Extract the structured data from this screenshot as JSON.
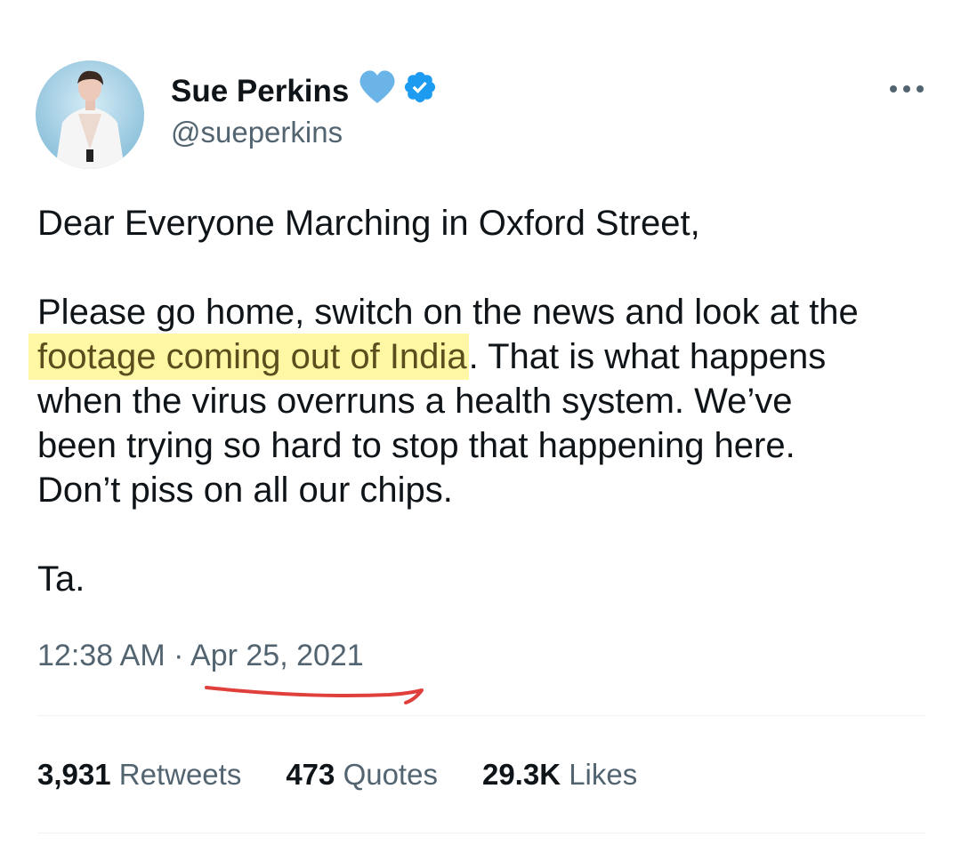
{
  "author": {
    "display_name": "Sue Perkins",
    "handle": "@sueperkins",
    "badges": [
      "blue-heart-icon",
      "verified-badge-icon"
    ]
  },
  "tweet": {
    "greeting": "Dear Everyone Marching in Oxford Street,",
    "body": {
      "line1": "Please go home, switch on the news and look at the",
      "highlighted": "footage coming out of India",
      "line2_rest": ". That is what happens",
      "line3": "when the virus overruns a health system. We’ve",
      "line4": "been trying so hard to stop that happening here.",
      "line5": "Don’t piss on all our chips."
    },
    "signoff": "Ta."
  },
  "meta": {
    "time": "12:38 AM",
    "separator": "·",
    "date": "Apr 25, 2021"
  },
  "stats": {
    "retweets": {
      "count": "3,931",
      "label": "Retweets"
    },
    "quotes": {
      "count": "473",
      "label": "Quotes"
    },
    "likes": {
      "count": "29.3K",
      "label": "Likes"
    }
  },
  "colors": {
    "text": "#0f1419",
    "secondary": "#536471",
    "verified": "#1d9bf0",
    "heart": "#6ab4e8",
    "highlight": "#fff05a",
    "annotation": "#e0403c"
  }
}
